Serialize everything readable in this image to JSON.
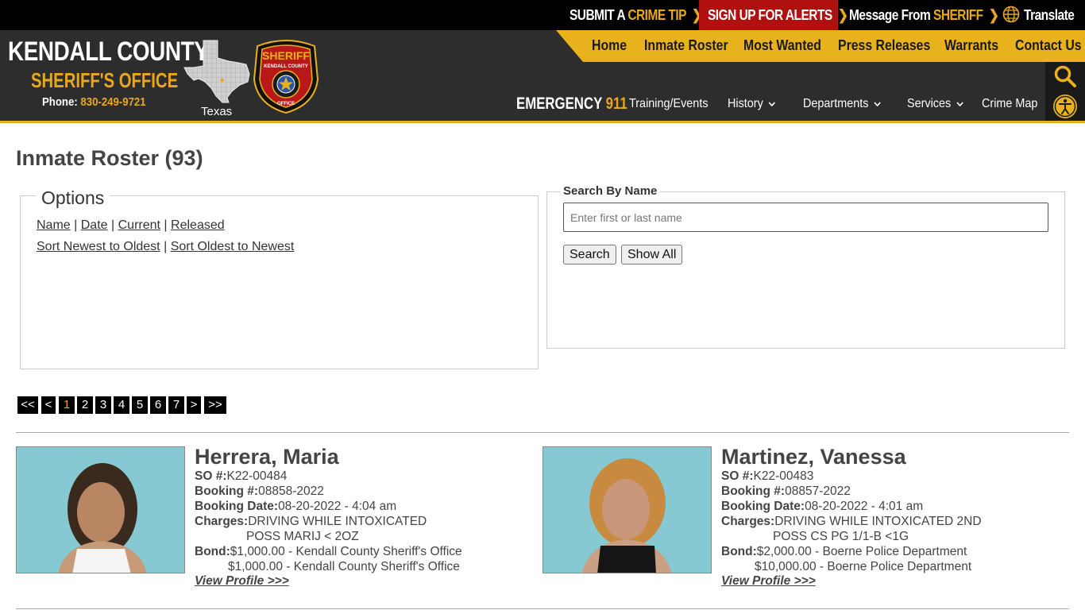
{
  "topbar": {
    "crime_tip_prefix": "SUBMIT A",
    "crime_tip_gold": "CRIME TIP",
    "alerts": "SIGN UP FOR ALERTS",
    "message_prefix": "Message From",
    "message_gold": "SHERIFF",
    "translate": "Translate",
    "chevron": "❯"
  },
  "header": {
    "title": "KENDALL COUNTY",
    "subtitle": "SHERIFF'S OFFICE",
    "phone_label": "Phone:",
    "phone_number": "830-249-9721",
    "state_label": "Texas",
    "badge_top": "SHERIFF",
    "badge_county": "KENDALL COUNTY",
    "badge_bottom": "OFFICE"
  },
  "main_nav": [
    "Home",
    "Inmate Roster",
    "Most Wanted",
    "Press Releases",
    "Warrants",
    "Contact Us"
  ],
  "secondary_nav": {
    "emergency_prefix": "EMERGENCY",
    "emergency_num": "911",
    "items": [
      "Training/Events",
      "History",
      "Departments",
      "Services",
      "Crime Map"
    ],
    "caret": "⌄"
  },
  "page": {
    "title": "Inmate Roster (93)"
  },
  "options": {
    "legend": "Options",
    "filters": [
      "Name",
      "Date",
      "Current",
      "Released"
    ],
    "sorts": [
      "Sort Newest to Oldest",
      "Sort Oldest to Newest"
    ],
    "separator": "|"
  },
  "search": {
    "legend": "Search By Name",
    "placeholder": "Enter first or last name",
    "value": "",
    "search_button": "Search",
    "show_all_button": "Show All"
  },
  "pagination": {
    "first": "<<",
    "prev": "<",
    "pages": [
      "1",
      "2",
      "3",
      "4",
      "5",
      "6",
      "7"
    ],
    "current": "1",
    "next": ">",
    "last": ">>"
  },
  "labels": {
    "so": "SO #:",
    "booking": "Booking #:",
    "booking_date": "Booking Date:",
    "charges": "Charges:",
    "bond": "Bond:",
    "view_profile": "View Profile >>>"
  },
  "inmates": [
    {
      "name": "Herrera, Maria",
      "so": "K22-00484",
      "booking": "08858-2022",
      "booking_date": "08-20-2022 - 4:04 am",
      "charges": [
        "DRIVING WHILE INTOXICATED",
        "POSS MARIJ < 2OZ"
      ],
      "bonds": [
        "$1,000.00 - Kendall County Sheriff's Office",
        "$1,000.00 - Kendall County Sheriff's Office"
      ]
    },
    {
      "name": "Martinez, Vanessa",
      "so": "K22-00483",
      "booking": "08857-2022",
      "booking_date": "08-20-2022 - 4:01 am",
      "charges": [
        "DRIVING WHILE INTOXICATED 2ND",
        "POSS CS PG 1/1-B <1G"
      ],
      "bonds": [
        "$2,000.00 - Boerne Police Department",
        "$10,000.00 - Boerne Police Department"
      ]
    }
  ],
  "colors": {
    "gold": "#e8b21c",
    "dark": "#2d2d2d",
    "alert_red": "#b01010"
  }
}
